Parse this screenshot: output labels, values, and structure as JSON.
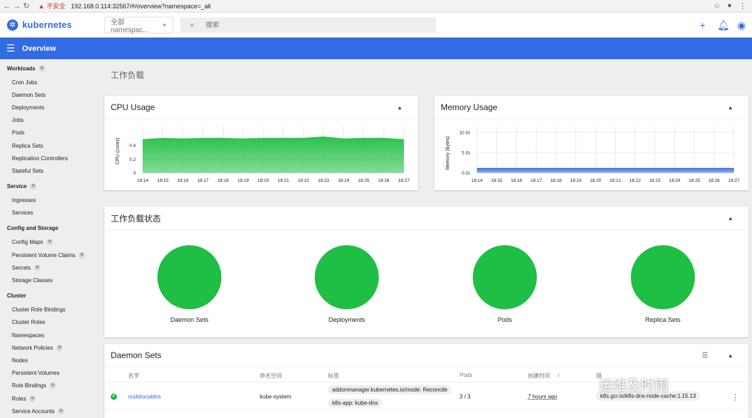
{
  "browser": {
    "insecure_label": "不安全",
    "url": "192.168.0.114:32567/#/overview?namespace=_all"
  },
  "header": {
    "logo_text": "kubernetes",
    "namespace_selected": "全部 namespac...",
    "search_placeholder": "搜索"
  },
  "title_bar": {
    "title": "Overview"
  },
  "sidebar": {
    "workloads": {
      "label": "Workloads",
      "badge": "N"
    },
    "workload_items": [
      "Cron Jobs",
      "Daemon Sets",
      "Deployments",
      "Jobs",
      "Pods",
      "Replica Sets",
      "Replication Controllers",
      "Stateful Sets"
    ],
    "service": {
      "label": "Service",
      "badge": "N"
    },
    "service_items": [
      "Ingresses",
      "Services"
    ],
    "config": {
      "label": "Config and Storage"
    },
    "config_items": [
      {
        "label": "Config Maps",
        "badge": "N"
      },
      {
        "label": "Persistent Volume Claims",
        "badge": "N"
      },
      {
        "label": "Secrets",
        "badge": "N"
      },
      {
        "label": "Storage Classes",
        "badge": ""
      }
    ],
    "cluster": {
      "label": "Cluster"
    },
    "cluster_items": [
      {
        "label": "Cluster Role Bindings",
        "badge": ""
      },
      {
        "label": "Cluster Roles",
        "badge": ""
      },
      {
        "label": "Namespaces",
        "badge": ""
      },
      {
        "label": "Network Policies",
        "badge": "N"
      },
      {
        "label": "Nodes",
        "badge": ""
      },
      {
        "label": "Persistent Volumes",
        "badge": ""
      },
      {
        "label": "Role Bindings",
        "badge": "N"
      },
      {
        "label": "Roles",
        "badge": "N"
      },
      {
        "label": "Service Accounts",
        "badge": "N"
      }
    ]
  },
  "main": {
    "section_title": "工作负载",
    "workload_status": {
      "title": "工作负载状态",
      "items": [
        "Daemon Sets",
        "Deployments",
        "Pods",
        "Replica Sets"
      ]
    },
    "daemon_sets": {
      "title": "Daemon Sets",
      "columns": [
        "名字",
        "命名空间",
        "标签",
        "Pods",
        "创建时间",
        "镜"
      ],
      "rows": [
        {
          "name": "nodelocaldns",
          "namespace": "kube-system",
          "labels": [
            "addonmanager.kubernetes.io/mode: Reconcile",
            "k8s-app: kube-dns"
          ],
          "pods": "3 / 3",
          "created": "7 hours ago",
          "image": "k8s.gcr.io/k8s-dns-node-cache:1.15.13"
        }
      ]
    }
  },
  "watermark": "运维及时雨",
  "chart_data": [
    {
      "type": "area",
      "title": "CPU Usage",
      "ylabel": "CPU (cores)",
      "x": [
        "18:14",
        "18:15",
        "18:16",
        "18:17",
        "18:18",
        "18:19",
        "18:20",
        "18:21",
        "18:22",
        "18:23",
        "18:24",
        "18:25",
        "18:26",
        "18:27"
      ],
      "yticks": [
        "0",
        "0.2",
        "0.4"
      ],
      "ylim": [
        0,
        0.62
      ],
      "series": [
        {
          "values": [
            0.49,
            0.51,
            0.5,
            0.51,
            0.51,
            0.5,
            0.51,
            0.51,
            0.51,
            0.53,
            0.5,
            0.51,
            0.51,
            0.49
          ]
        }
      ],
      "color": "#1fbe44"
    },
    {
      "type": "area",
      "title": "Memory Usage",
      "ylabel": "Memory (bytes)",
      "x": [
        "18:14",
        "18:15",
        "18:16",
        "18:17",
        "18:18",
        "18:19",
        "18:20",
        "18:21",
        "18:22",
        "18:23",
        "18:24",
        "18:25",
        "18:26",
        "18:27"
      ],
      "yticks": [
        "0 Gi",
        "5 Gi",
        "10 Gi"
      ],
      "ylim": [
        0,
        10.5
      ],
      "series": [
        {
          "values": [
            1.2,
            1.2,
            1.2,
            1.2,
            1.2,
            1.2,
            1.2,
            1.2,
            1.2,
            1.2,
            1.2,
            1.2,
            1.2,
            1.2
          ]
        }
      ],
      "color": "#326ce5"
    }
  ]
}
